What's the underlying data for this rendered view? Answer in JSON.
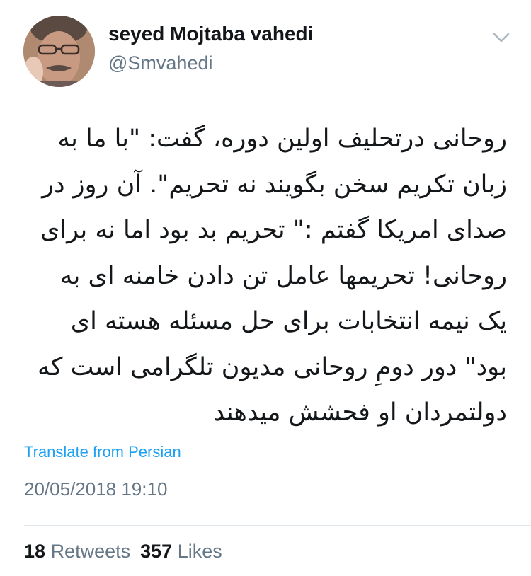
{
  "user": {
    "display_name": "seyed Mojtaba vahedi",
    "handle": "@Smvahedi",
    "avatar_icon": "profile-photo"
  },
  "menu": {
    "icon": "chevron-down-icon"
  },
  "tweet": {
    "lines": [
      "روحانی درتحلیف اولین دوره، گفت:  \"با ما به",
      "زبان تکریم سخن بگویند نه تحریم\". آن روز در",
      "صدای امریکا گفتم :\" تحریم  بد بود اما نه برای",
      "روحانی! تحریمها عامل تن دادن خامنه ای به",
      "یک نیمه انتخابات برای حل مسئله  هسته ای",
      "بود\" دور دومِ روحانی مدیون تلگرامی است که",
      "دولتمردان او فحشش میدهند"
    ],
    "translate_label": "Translate from Persian",
    "timestamp": "20/05/2018 19:10"
  },
  "stats": {
    "retweets_count": "18",
    "retweets_label": "Retweets",
    "likes_count": "357",
    "likes_label": "Likes"
  },
  "colors": {
    "link": "#1da1f2",
    "muted": "#657786",
    "text": "#14171a",
    "divider": "#e1e8ed"
  }
}
